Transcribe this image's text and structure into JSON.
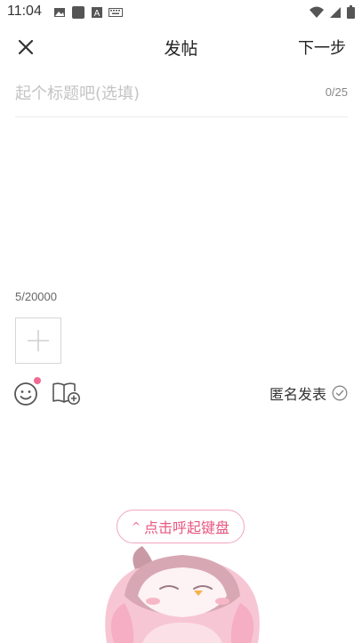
{
  "status": {
    "time": "11:04",
    "left_icons": [
      "image-icon",
      "square-app-icon",
      "font-a-icon",
      "keyboard-icon"
    ],
    "right_icons": [
      "wifi-icon",
      "signal-icon",
      "battery-icon"
    ]
  },
  "header": {
    "title": "发帖",
    "next_label": "下一步"
  },
  "title_field": {
    "placeholder": "起个标题吧(选填)",
    "value": "",
    "count": "0/25"
  },
  "content_field": {
    "value": "",
    "count": "5/20000"
  },
  "toolbar": {
    "anonymous_label": "匿名发表"
  },
  "keyboard_button": {
    "label": "点击呼起键盘"
  },
  "colors": {
    "accent": "#e8577f",
    "accent_border": "#f3a6bd",
    "notification_dot": "#f06a92",
    "divider": "#ececec",
    "placeholder": "#c4c4c4"
  }
}
